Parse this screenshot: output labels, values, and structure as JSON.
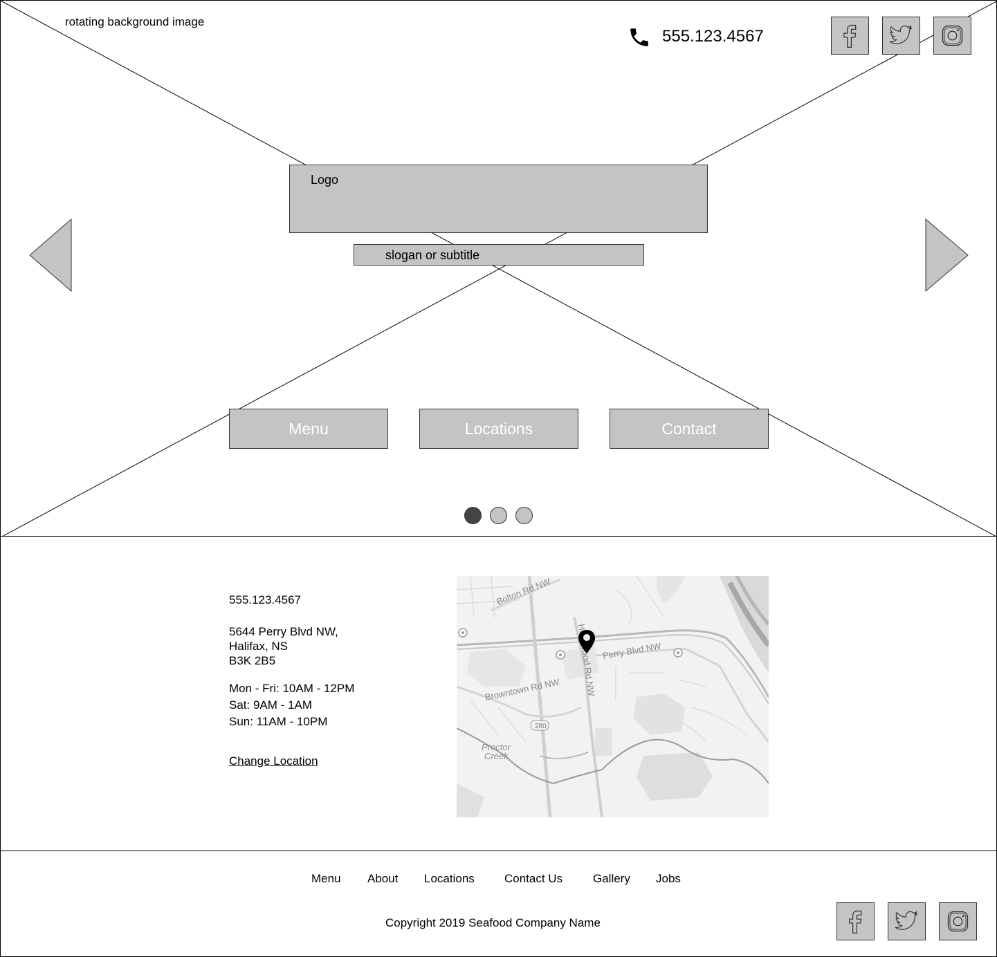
{
  "hero": {
    "background_label": "rotating background image",
    "phone": "555.123.4567",
    "logo_label": "Logo",
    "slogan_label": "slogan or subtitle",
    "nav_buttons": [
      "Menu",
      "Locations",
      "Contact"
    ],
    "slides_total": 3,
    "active_slide": 1
  },
  "location": {
    "phone": "555.123.4567",
    "address": [
      "5644 Perry Blvd NW,",
      "Halifax, NS",
      "B3K 2B5"
    ],
    "hours": [
      "Mon - Fri: 10AM - 12PM",
      "Sat: 9AM - 1AM",
      "Sun: 11AM - 10PM"
    ],
    "change_location": "Change Location",
    "map": {
      "streets": [
        "Bolton Rd NW",
        "Perry Blvd NW",
        "Browntown Rd NW",
        "Hollywood Rd NW"
      ],
      "route_badge": "280",
      "place": [
        "Proctor",
        "Creek"
      ],
      "pin_icon": "map-pin-icon"
    }
  },
  "footer": {
    "links": [
      "Menu",
      "About",
      "Locations",
      "Contact Us",
      "Gallery",
      "Jobs"
    ],
    "copyright": "Copyright 2019 Seafood Company Name"
  },
  "social_icons": [
    "facebook-icon",
    "twitter-icon",
    "instagram-icon"
  ],
  "colors": {
    "placeholder_fill": "#c4c4c4",
    "active_dot": "#444444",
    "map_bg": "#f2f2f2",
    "map_road": "#cfcfcf"
  }
}
